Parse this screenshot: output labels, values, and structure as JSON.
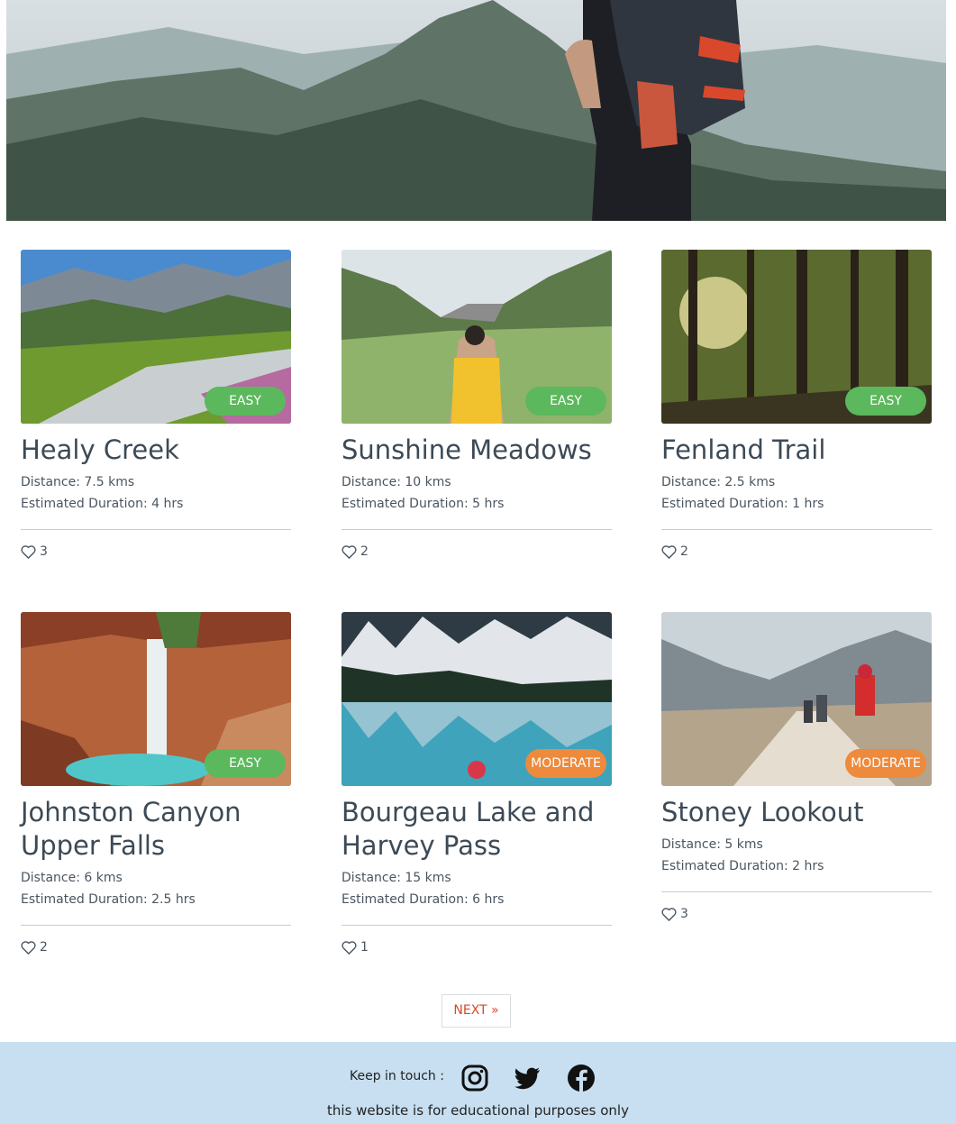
{
  "trails": [
    {
      "name": "Healy Creek",
      "difficulty": "EASY",
      "distance": "Distance: 7.5 kms",
      "duration": "Estimated Duration: 4 hrs",
      "likes": "3"
    },
    {
      "name": "Sunshine Meadows",
      "difficulty": "EASY",
      "distance": "Distance: 10 kms",
      "duration": "Estimated Duration: 5 hrs",
      "likes": "2"
    },
    {
      "name": "Fenland Trail",
      "difficulty": "EASY",
      "distance": "Distance: 2.5 kms",
      "duration": "Estimated Duration: 1 hrs",
      "likes": "2"
    },
    {
      "name": "Johnston Canyon Upper Falls",
      "difficulty": "EASY",
      "distance": "Distance: 6 kms",
      "duration": "Estimated Duration: 2.5 hrs",
      "likes": "2"
    },
    {
      "name": "Bourgeau Lake and Harvey Pass",
      "difficulty": "MODERATE",
      "distance": "Distance: 15 kms",
      "duration": "Estimated Duration: 6 hrs",
      "likes": "1"
    },
    {
      "name": "Stoney Lookout",
      "difficulty": "MODERATE",
      "distance": "Distance: 5 kms",
      "duration": "Estimated Duration: 2 hrs",
      "likes": "3"
    }
  ],
  "pagination": {
    "next_label": "NEXT »"
  },
  "footer": {
    "keep_in_touch": "Keep in touch :",
    "social_icons": [
      "instagram-icon",
      "twitter-icon",
      "facebook-icon"
    ],
    "note": "this website is for educational purposes only"
  },
  "colors": {
    "easy": "#5cb85c",
    "moderate": "#ee8a3c",
    "footer_bg": "#c7dff0",
    "next_link": "#d9482b"
  }
}
